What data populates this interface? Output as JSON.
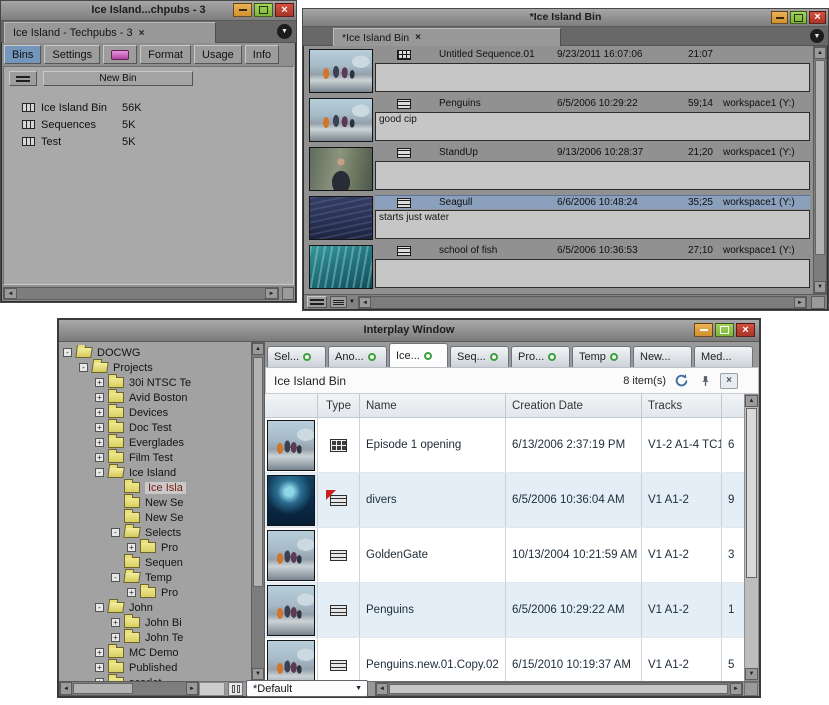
{
  "colors": {
    "accent_blue": "#7496bc",
    "selection_blue": "#8aa0bd",
    "tab_status_green": "#3f9e42",
    "alt_row_blue": "#e4eef7"
  },
  "bin_window": {
    "title": "Ice Island...chpubs - 3",
    "tab_label": "Ice Island - Techpubs - 3",
    "tab_close": "×",
    "toolbar": {
      "bins": "Bins",
      "settings": "Settings",
      "format": "Format",
      "usage": "Usage",
      "info": "Info"
    },
    "new_bin_label": "New Bin",
    "bins": [
      {
        "name": "Ice Island Bin",
        "size": "56K"
      },
      {
        "name": "Sequences",
        "size": "5K"
      },
      {
        "name": "Test",
        "size": "5K"
      }
    ]
  },
  "clip_window": {
    "title": "*Ice Island Bin",
    "tab_label": "*Ice Island Bin",
    "tab_close": "×",
    "rows": [
      {
        "name": "Untitled Sequence.01",
        "date": "9/23/2011 16:07:06",
        "duration": "21:07",
        "workspace": "",
        "comment": "",
        "icon": "sequence",
        "thumb": "penguins",
        "selected": false
      },
      {
        "name": "Penguins",
        "date": "6/5/2006 10:29:22",
        "duration": "59;14",
        "workspace": "workspace1 (Y:)",
        "comment": "good cip",
        "icon": "clip",
        "thumb": "penguins",
        "selected": false
      },
      {
        "name": "StandUp",
        "date": "9/13/2006 10:28:37",
        "duration": "21;20",
        "workspace": "workspace1 (Y:)",
        "comment": "",
        "icon": "clip",
        "thumb": "standup",
        "selected": false
      },
      {
        "name": "Seagull",
        "date": "6/6/2006 10:48:24",
        "duration": "35;25",
        "workspace": "workspace1 (Y:)",
        "comment": "starts just water",
        "icon": "clip",
        "thumb": "water-dark",
        "selected": true
      },
      {
        "name": "school of fish",
        "date": "6/5/2006 10:36:53",
        "duration": "27;10",
        "workspace": "workspace1 (Y:)",
        "comment": "",
        "icon": "clip",
        "thumb": "water-teal",
        "selected": false
      }
    ]
  },
  "interplay": {
    "title": "Interplay Window",
    "tree": [
      {
        "label": "DOCWG",
        "level": 0,
        "expander": "-",
        "open": true,
        "selected": false
      },
      {
        "label": "Projects",
        "level": 1,
        "expander": "-",
        "open": true,
        "selected": false
      },
      {
        "label": "30i NTSC Te",
        "level": 2,
        "expander": "+",
        "open": false,
        "selected": false
      },
      {
        "label": "Avid Boston",
        "level": 2,
        "expander": "+",
        "open": false,
        "selected": false
      },
      {
        "label": "Devices",
        "level": 2,
        "expander": "+",
        "open": false,
        "selected": false
      },
      {
        "label": "Doc Test",
        "level": 2,
        "expander": "+",
        "open": false,
        "selected": false
      },
      {
        "label": "Everglades",
        "level": 2,
        "expander": "+",
        "open": false,
        "selected": false
      },
      {
        "label": "Film Test",
        "level": 2,
        "expander": "+",
        "open": false,
        "selected": false
      },
      {
        "label": "Ice Island",
        "level": 2,
        "expander": "-",
        "open": true,
        "selected": false
      },
      {
        "label": "Ice Isla",
        "level": 3,
        "expander": "",
        "open": false,
        "selected": true
      },
      {
        "label": "New Se",
        "level": 3,
        "expander": "",
        "open": false,
        "selected": false
      },
      {
        "label": "New Se",
        "level": 3,
        "expander": "",
        "open": false,
        "selected": false
      },
      {
        "label": "Selects",
        "level": 3,
        "expander": "-",
        "open": true,
        "selected": false
      },
      {
        "label": "Pro",
        "level": 4,
        "expander": "+",
        "open": false,
        "selected": false
      },
      {
        "label": "Sequen",
        "level": 3,
        "expander": "",
        "open": false,
        "selected": false
      },
      {
        "label": "Temp",
        "level": 3,
        "expander": "-",
        "open": true,
        "selected": false
      },
      {
        "label": "Pro",
        "level": 4,
        "expander": "+",
        "open": false,
        "selected": false
      },
      {
        "label": "John",
        "level": 2,
        "expander": "-",
        "open": true,
        "selected": false
      },
      {
        "label": "John Bi",
        "level": 3,
        "expander": "+",
        "open": false,
        "selected": false
      },
      {
        "label": "John Te",
        "level": 3,
        "expander": "+",
        "open": false,
        "selected": false
      },
      {
        "label": "MC Demo",
        "level": 2,
        "expander": "+",
        "open": false,
        "selected": false
      },
      {
        "label": "Published",
        "level": 2,
        "expander": "+",
        "open": false,
        "selected": false
      },
      {
        "label": "scarlet",
        "level": 2,
        "expander": "+",
        "open": false,
        "selected": false
      }
    ],
    "tabs": [
      {
        "label": "Sel...",
        "status": true,
        "active": false
      },
      {
        "label": "Ano...",
        "status": true,
        "active": false
      },
      {
        "label": "Ice...",
        "status": true,
        "active": true
      },
      {
        "label": "Seq...",
        "status": true,
        "active": false
      },
      {
        "label": "Pro...",
        "status": true,
        "active": false
      },
      {
        "label": "Temp",
        "status": true,
        "active": false
      },
      {
        "label": "New...",
        "status": false,
        "active": false
      },
      {
        "label": "Med...",
        "status": false,
        "active": false
      }
    ],
    "panel": {
      "title": "Ice Island Bin",
      "count": "8 item(s)"
    },
    "table": {
      "headers": {
        "type": "Type",
        "name": "Name",
        "creation_date": "Creation Date",
        "tracks": "Tracks"
      },
      "rows": [
        {
          "thumb": "penguins",
          "type": "sequence",
          "name": "Episode 1 opening",
          "date": "6/13/2006 2:37:19 PM",
          "tracks": "V1-2 A1-4 TC1",
          "extra": "6"
        },
        {
          "thumb": "divers",
          "type": "clip-flag",
          "name": "divers",
          "date": "6/5/2006 10:36:04 AM",
          "tracks": "V1 A1-2",
          "extra": "9"
        },
        {
          "thumb": "penguins",
          "type": "clip",
          "name": "GoldenGate",
          "date": "10/13/2004 10:21:59 AM",
          "tracks": "V1 A1-2",
          "extra": "3"
        },
        {
          "thumb": "penguins",
          "type": "clip",
          "name": "Penguins",
          "date": "6/5/2006 10:29:22 AM",
          "tracks": "V1 A1-2",
          "extra": "1"
        },
        {
          "thumb": "penguins",
          "type": "clip",
          "name": "Penguins.new.01.Copy.02",
          "date": "6/15/2010 10:19:37 AM",
          "tracks": "V1 A1-2",
          "extra": "5"
        }
      ]
    },
    "footer": {
      "preset": "*Default"
    }
  }
}
